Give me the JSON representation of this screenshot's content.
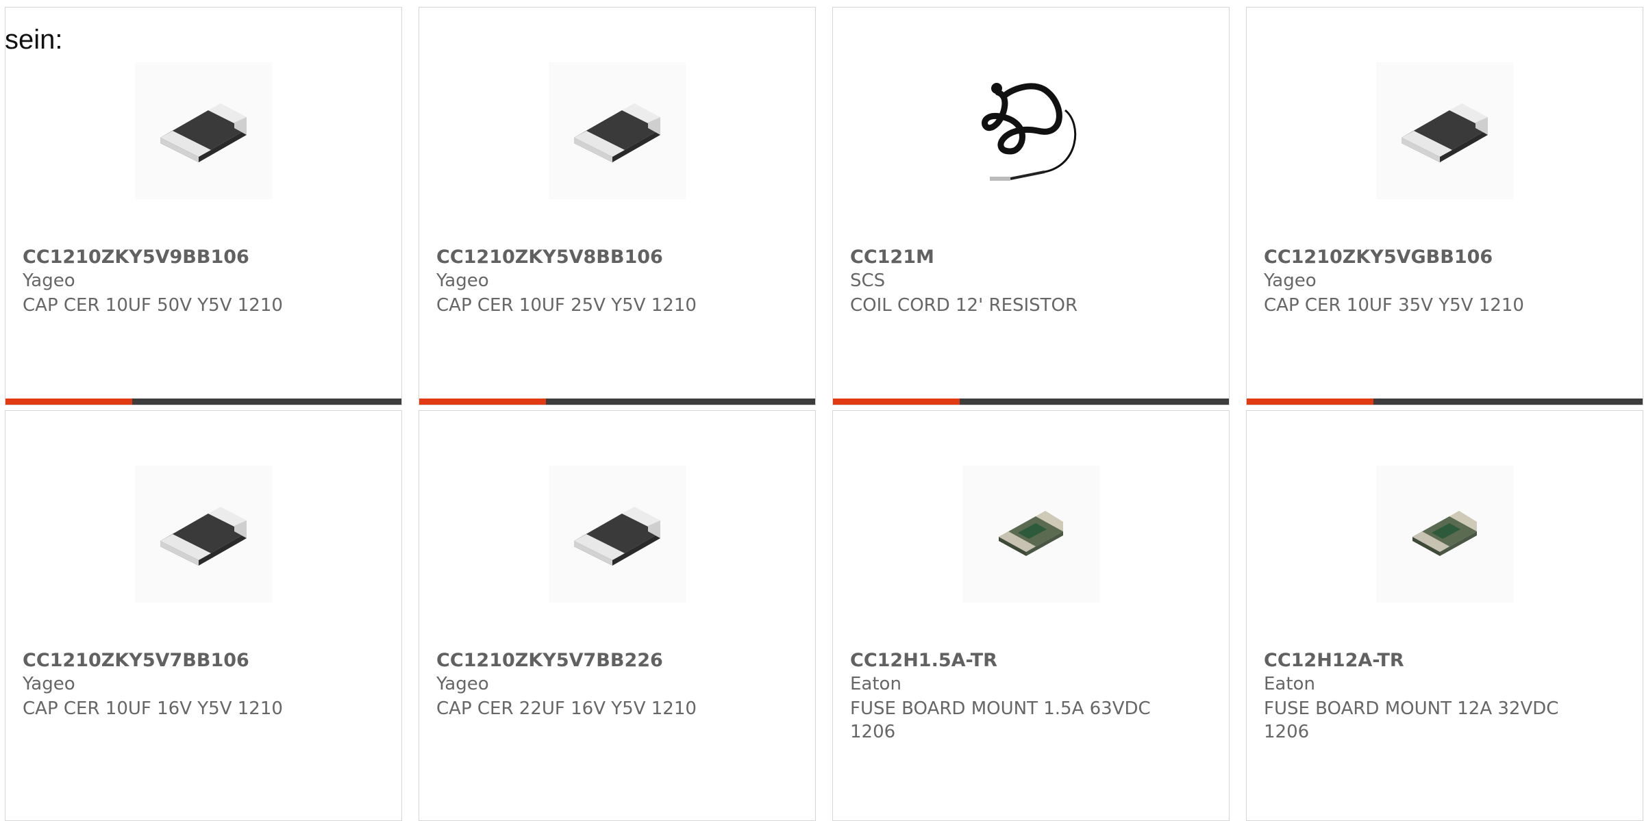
{
  "intro_text": "sein:",
  "colors": {
    "accent": "#e23b13",
    "bar_dark": "#3d3d3d",
    "border": "#d6d6d6",
    "text": "#616161"
  },
  "products": [
    {
      "part": "CC1210ZKY5V9BB106",
      "maker": "Yageo",
      "desc": "CAP CER 10UF 50V Y5V 1210",
      "icon": "capacitor-chip-icon",
      "accent_fraction": 0.32
    },
    {
      "part": "CC1210ZKY5V8BB106",
      "maker": "Yageo",
      "desc": "CAP CER 10UF 25V Y5V 1210",
      "icon": "capacitor-chip-icon",
      "accent_fraction": 0.32
    },
    {
      "part": "CC121M",
      "maker": "SCS",
      "desc": "COIL CORD 12' RESISTOR",
      "icon": "coil-cord-icon",
      "accent_fraction": 0.32
    },
    {
      "part": "CC1210ZKY5VGBB106",
      "maker": "Yageo",
      "desc": "CAP CER 10UF 35V Y5V 1210",
      "icon": "capacitor-chip-icon",
      "accent_fraction": 0.32
    },
    {
      "part": "CC1210ZKY5V7BB106",
      "maker": "Yageo",
      "desc": "CAP CER 10UF 16V Y5V 1210",
      "icon": "capacitor-chip-icon"
    },
    {
      "part": "CC1210ZKY5V7BB226",
      "maker": "Yageo",
      "desc": "CAP CER 22UF 16V Y5V 1210",
      "icon": "capacitor-chip-icon"
    },
    {
      "part": "CC12H1.5A-TR",
      "maker": "Eaton",
      "desc": "FUSE BOARD MOUNT 1.5A 63VDC 1206",
      "icon": "fuse-chip-icon"
    },
    {
      "part": "CC12H12A-TR",
      "maker": "Eaton",
      "desc": "FUSE BOARD MOUNT 12A 32VDC 1206",
      "icon": "fuse-chip-icon"
    }
  ]
}
